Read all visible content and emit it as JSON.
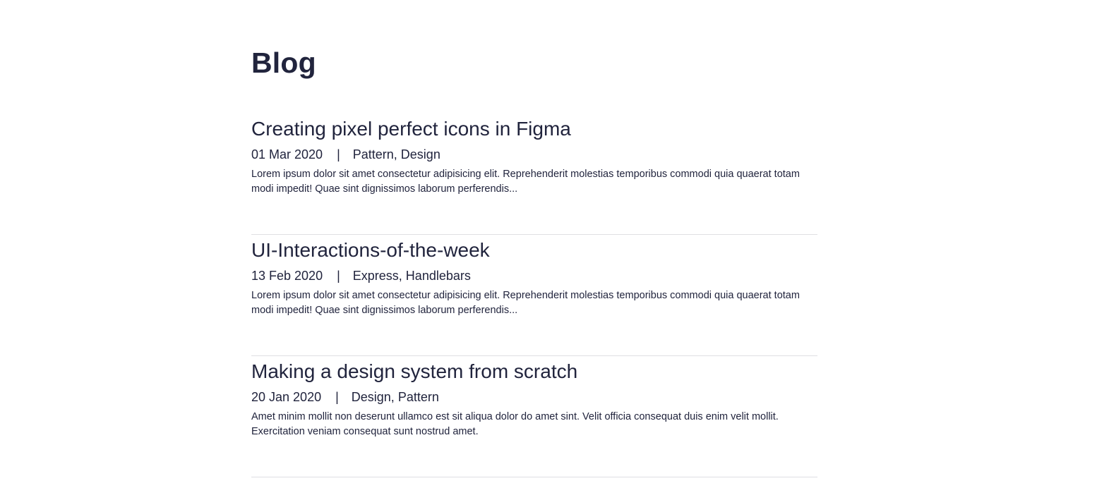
{
  "page": {
    "title": "Blog"
  },
  "posts": [
    {
      "title": "Creating pixel perfect icons in Figma",
      "date": "01 Mar 2020",
      "separator": "|",
      "tags": "Pattern, Design",
      "excerpt": "Lorem ipsum dolor sit amet consectetur adipisicing elit. Reprehenderit molestias temporibus commodi quia quaerat totam modi impedit! Quae sint dignissimos laborum perferendis..."
    },
    {
      "title": "UI-Interactions-of-the-week",
      "date": "13 Feb 2020",
      "separator": "|",
      "tags": "Express, Handlebars",
      "excerpt": "Lorem ipsum dolor sit amet consectetur adipisicing elit. Reprehenderit molestias temporibus commodi quia quaerat totam modi impedit! Quae sint dignissimos laborum perferendis..."
    },
    {
      "title": "Making a design system from scratch",
      "date": "20 Jan 2020",
      "separator": "|",
      "tags": "Design, Pattern",
      "excerpt": "Amet minim mollit non deserunt ullamco est sit aliqua dolor do amet sint. Velit officia consequat duis enim velit mollit. Exercitation veniam consequat sunt nostrud amet."
    }
  ],
  "colors": {
    "text": "#21243d",
    "divider": "#dfdfe3",
    "background": "#ffffff"
  }
}
